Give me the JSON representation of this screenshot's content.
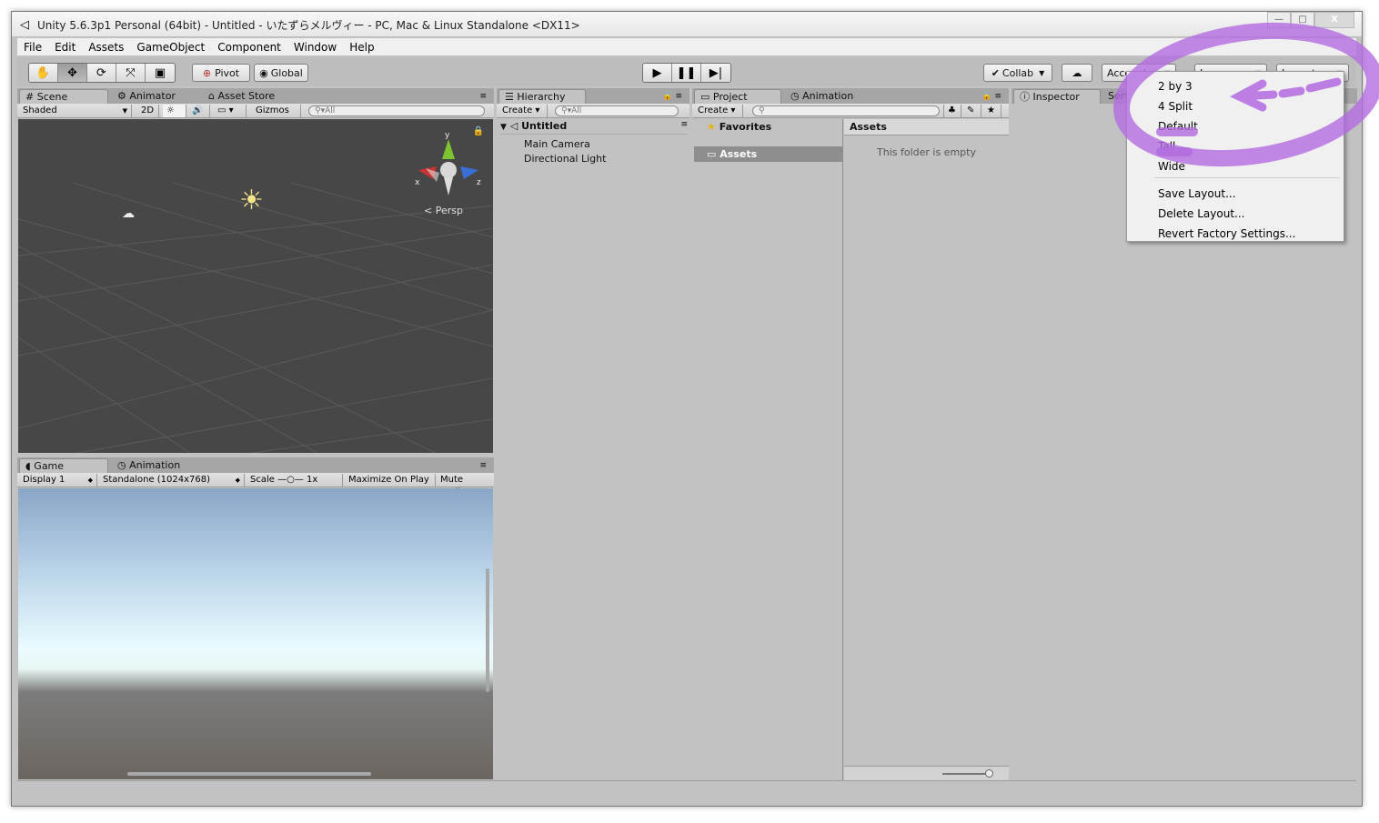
{
  "window": {
    "title": "Unity 5.6.3p1 Personal (64bit) - Untitled - いたずらメルヴィー - PC, Mac & Linux Standalone <DX11>",
    "controls": {
      "minimize": "—",
      "maximize": "□",
      "close": "X"
    }
  },
  "menubar": [
    "File",
    "Edit",
    "Assets",
    "GameObject",
    "Component",
    "Window",
    "Help"
  ],
  "toolbar": {
    "pivot": "Pivot",
    "global": "Global",
    "collab": "Collab",
    "account": "Account",
    "layers": "Layers",
    "layout": "Layout"
  },
  "scene_panel": {
    "tabs": [
      "Scene",
      "Animator",
      "Asset Store"
    ],
    "shading": "Shaded",
    "mode_2d": "2D",
    "gizmos": "Gizmos",
    "search_placeholder": "All",
    "persp": "Persp",
    "axis_y": "y",
    "axis_x": "x",
    "axis_z": "z"
  },
  "game_panel": {
    "tabs": [
      "Game",
      "Animation"
    ],
    "display": "Display 1",
    "resolution": "Standalone (1024x768)",
    "scale_label": "Scale",
    "scale_value": "1x",
    "maximize": "Maximize On Play",
    "mute": "Mute Audio"
  },
  "hierarchy": {
    "tab": "Hierarchy",
    "create": "Create",
    "search_placeholder": "All",
    "scene": "Untitled",
    "items": [
      "Main Camera",
      "Directional Light"
    ]
  },
  "project": {
    "tabs": [
      "Project",
      "Animation"
    ],
    "create": "Create",
    "favorites": "Favorites",
    "assets_folder": "Assets",
    "assets_header": "Assets",
    "empty_msg": "This folder is empty"
  },
  "inspector": {
    "tabs": [
      "Inspector",
      "Servi"
    ]
  },
  "layout_menu": {
    "items": [
      "2 by 3",
      "4 Split",
      "Default",
      "Tall",
      "Wide"
    ],
    "actions": [
      "Save Layout...",
      "Delete Layout...",
      "Revert Factory Settings..."
    ]
  },
  "colors": {
    "annotation": "#b36be0"
  }
}
